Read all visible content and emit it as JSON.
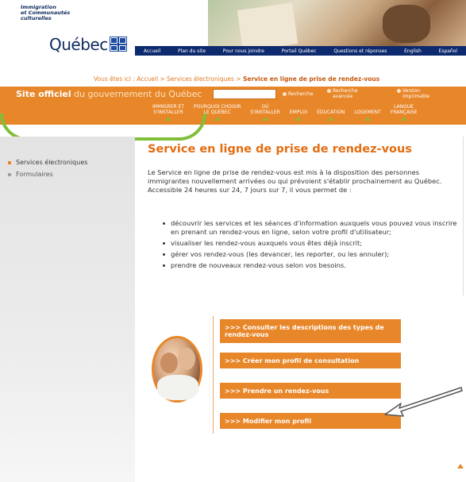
{
  "header": {
    "ministry_line1": "Immigration",
    "ministry_line2": "et Communautés",
    "ministry_line3": "culturelles",
    "wordmark": "Québec",
    "topnav": [
      "Accueil",
      "Plan du site",
      "Pour nous joindre",
      "Portail Québec",
      "Questions et réponses",
      "English",
      "Español"
    ]
  },
  "breadcrumb": {
    "prefix": "Vous êtes ici :",
    "items": [
      "Accueil",
      "Services électroniques"
    ],
    "separator": ">",
    "current": "Service en ligne de prise de rendez-vous"
  },
  "officialbar": {
    "site_bold": "Site officiel",
    "site_rest": "du gouvernement du Québec",
    "search_value": "",
    "search_button": "Recherche",
    "advanced_search_l1": "Recherche",
    "advanced_search_l2": "avancée",
    "printable_l1": "Version",
    "printable_l2": "imprimable"
  },
  "catnav": [
    {
      "l1": "IMMIGRER ET",
      "l2": "S'INSTALLER"
    },
    {
      "l1": "POURQUOI CHOISIR",
      "l2": "LE QUÉBEC"
    },
    {
      "l1": "OÙ",
      "l2": "S'INSTALLER"
    },
    {
      "l1": "",
      "l2": "EMPLOI"
    },
    {
      "l1": "",
      "l2": "ÉDUCATION"
    },
    {
      "l1": "",
      "l2": "LOGEMENT"
    },
    {
      "l1": "LANGUE",
      "l2": "FRANÇAISE"
    }
  ],
  "sidebar": {
    "items": [
      {
        "label": "Services électroniques"
      },
      {
        "label": "Formulaires"
      }
    ]
  },
  "main": {
    "title": "Service en ligne de prise de rendez-vous",
    "intro": "Le Service en ligne de prise de rendez-vous est mis à la disposition des personnes immigrantes nouvellement arrivées ou qui prévoient s'établir prochainement au Québec. Accessible 24 heures sur 24, 7 jours sur 7, il vous permet de :",
    "bullets": [
      "découvrir les services et les séances d'information auxquels vous pouvez vous inscrire en prenant un rendez-vous en ligne, selon votre profil d'utilisateur;",
      "visualiser les rendez-vous auxquels vous êtes déjà inscrit;",
      "gérer vos rendez-vous (les devancer, les reporter, ou les annuler);",
      "prendre de nouveaux rendez-vous selon vos besoins."
    ],
    "actions": [
      ">>> Consulter les descriptions des types de rendez-vous",
      ">>> Créer mon profil de consultation",
      ">>> Prendre un rendez-vous",
      ">>> Modifier mon profil"
    ]
  },
  "colors": {
    "orange": "#e8872a",
    "title_orange": "#e36d12",
    "navy": "#0d2a6e",
    "green_arc": "#7fbf3a"
  }
}
